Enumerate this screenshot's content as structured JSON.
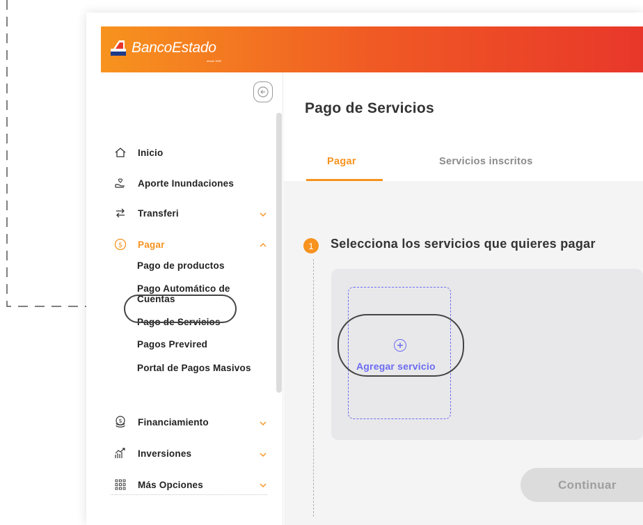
{
  "brand": {
    "name": "BancoEstado",
    "tagline": "desde 1855",
    "colors": {
      "orange": "#f7931e",
      "red": "#e8372a",
      "violet": "#6b6bf2"
    }
  },
  "sidebar": {
    "collapse_icon": "arrow-left-icon",
    "items": [
      {
        "label": "Inicio",
        "icon": "home-icon"
      },
      {
        "label": "Aporte Inundaciones",
        "icon": "hand-heart-icon"
      },
      {
        "label": "Transferi",
        "icon": "transfer-arrows-icon"
      },
      {
        "label": "Pagar",
        "icon": "dollar-circle-icon"
      },
      {
        "label": "Financiamiento",
        "icon": "coins-icon"
      },
      {
        "label": "Inversiones",
        "icon": "growth-chart-icon"
      },
      {
        "label": "Más Opciones",
        "icon": "grid-icon"
      }
    ],
    "pagar_subitems": [
      {
        "label": "Pago de productos"
      },
      {
        "label": "Pago Automático de Cuentas"
      },
      {
        "label": "Pago de Servicios"
      },
      {
        "label": "Pagos Previred"
      },
      {
        "label": "Portal de Pagos Masivos"
      }
    ]
  },
  "main": {
    "title": "Pago de Servicios",
    "tabs": [
      {
        "label": "Pagar",
        "active": true
      },
      {
        "label": "Servicios inscritos",
        "active": false
      }
    ],
    "step": {
      "number": "1",
      "title": "Selecciona los servicios que quieres pagar"
    },
    "add_service": {
      "label": "Agregar servicio",
      "icon": "plus-circle-icon"
    },
    "continue_button": "Continuar"
  }
}
